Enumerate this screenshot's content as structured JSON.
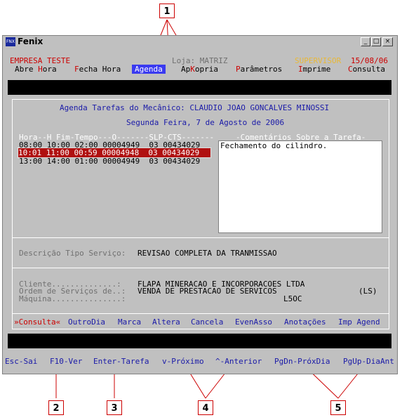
{
  "window": {
    "title": "Fenix",
    "icon_text": "FNX"
  },
  "header": {
    "company": "EMPRESA TESTE",
    "store": "Loja: MATRIZ",
    "user": "SUPERVISOR",
    "date": "15/08/06"
  },
  "menu": [
    {
      "hot": "",
      "label": "Abre ",
      "hot2": "H",
      "rest": "ora"
    },
    {
      "hot": "F",
      "rest": "echa Hora"
    },
    {
      "label": "Agenda"
    },
    {
      "pre": "Ap",
      "hot": "K",
      "rest": "opria"
    },
    {
      "hot": "P",
      "rest": "arâmetros"
    },
    {
      "hot": "I",
      "rest": "mprime"
    },
    {
      "hot": "C",
      "rest": "onsulta"
    }
  ],
  "agenda": {
    "title": "Agenda Tarefas do Mecânico: CLAUDIO JOAO GONCALVES MINOSSI",
    "date_line": "Segunda Feira, 7 de Agosto de 2006",
    "columns_header": "Hora--H Fim-Tempo---O-------SLP-CTS-------",
    "comments_header": "-Comentários Sobre a Tarefa-",
    "rows": [
      "08:00 10:00 02:00 00004949  03 00434029",
      "10:01 11:00 00:59 00004948  03 00434029",
      "13:00 14:00 01:00 00004949  03 00434029"
    ],
    "selected_row": 1,
    "comment_text": "Fechamento do cilindro."
  },
  "service": {
    "label": "Descrição Tipo Serviço:",
    "value": "REVISAO COMPLETA DA TRANMISSAO"
  },
  "details": {
    "cliente_label": "Cliente..............:",
    "cliente_value": "FLAPA MINERACAO E INCORPORACOES LTDA",
    "os_label": "Ordem de Serviços de..:",
    "os_value": "VENDA DE PRESTACAO DE SERVICOS",
    "os_code": "(LS)",
    "maquina_label": "Máquina...............:",
    "maquina_value": "L5OC"
  },
  "actions": [
    "»Consulta«",
    "OutroDia",
    "Marca",
    "Altera",
    "Cancela",
    "EvenAsso",
    "Anotações",
    "Imp Agend"
  ],
  "function_keys": [
    "Esc-Sai",
    "F10-Ver",
    "Enter-Tarefa",
    "v-Próximo",
    "^-Anterior",
    "PgDn-PróxDia",
    "PgUp-DiaAnt"
  ],
  "callouts": [
    "1",
    "2",
    "3",
    "4",
    "5"
  ],
  "colors": {
    "accent_red": "#cc0000",
    "highlight_row": "#b01010",
    "menu_active": "#3a3af0",
    "text_blue": "#1a1aa8"
  }
}
